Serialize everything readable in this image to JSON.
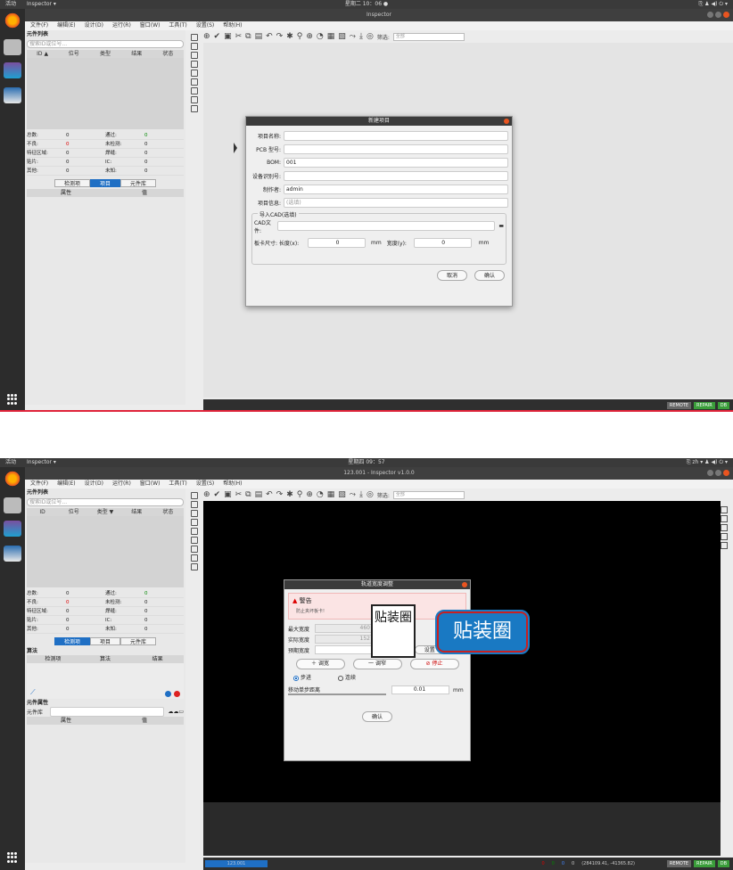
{
  "s1": {
    "topbar": {
      "activities": "活动",
      "app": "Inspector ▾",
      "clock": "星期二 10：06 ●",
      "tray": "⎘   ♟ ◀) ⏻ ▾"
    },
    "title": "Inspector",
    "menu": [
      "文件(F)",
      "编辑(E)",
      "设计(D)",
      "运行(R)",
      "窗口(W)",
      "工具(T)",
      "设置(S)",
      "帮助(H)"
    ],
    "left": {
      "title": "元件列表",
      "search_placeholder": "搜索ID或位号...",
      "cols": [
        "ID ▲",
        "位号",
        "类型",
        "结果",
        "状态"
      ],
      "stats": [
        [
          "总数:",
          "0",
          "通过:",
          "0"
        ],
        [
          "不良:",
          "0",
          "未检测:",
          "0"
        ],
        [
          "特征区域:",
          "0",
          "焊缝:",
          "0"
        ],
        [
          "贴片:",
          "0",
          "IC:",
          "0"
        ],
        [
          "其他:",
          "0",
          "未知:",
          "0"
        ]
      ],
      "tabs": [
        "检测项",
        "项目",
        "元件库"
      ],
      "attr_cols": [
        "属性",
        "值"
      ]
    },
    "filter_label": "筛选:",
    "filter_value": "全部",
    "dialog": {
      "title": "新建项目",
      "fields": [
        {
          "label": "项目名称:",
          "value": "",
          "ph": false
        },
        {
          "label": "PCB 型号:",
          "value": "",
          "ph": false
        },
        {
          "label": "BOM:",
          "value": "001",
          "ph": false
        },
        {
          "label": "设备识别号:",
          "value": "",
          "ph": false
        },
        {
          "label": "制作者:",
          "value": "admin",
          "ph": false
        },
        {
          "label": "项目信息:",
          "value": "(选填)",
          "ph": true
        }
      ],
      "group_label": "导入CAD(选填)",
      "cad_label": "CAD文件:",
      "size_label": "板卡尺寸: 长度(x):",
      "length": "0",
      "mm": "mm",
      "width_label": "宽度(y):",
      "width": "0",
      "cancel": "取消",
      "ok": "确认"
    },
    "status": {
      "remote": "REMOTE",
      "repair": "REPAIR",
      "db": "DB"
    }
  },
  "s2": {
    "topbar": {
      "activities": "活动",
      "app": "Inspector ▾",
      "clock": "星期四 09：57",
      "tray": "⎘  zh ▾   ♟ ◀) ⏻ ▾"
    },
    "title": "123.001 - Inspector v1.0.0",
    "left": {
      "tabs": [
        "检测项",
        "项目",
        "元件库"
      ],
      "algo_title": "算法",
      "algo_cols": [
        "检测项",
        "算法",
        "结果"
      ],
      "comp_title": "元件属性",
      "lib_label": "元件库",
      "attr_cols": [
        "属性",
        "值"
      ],
      "cols": [
        "ID",
        "位号",
        "类型 ▼",
        "结果",
        "状态"
      ]
    },
    "dialog": {
      "title": "轨道宽度调整",
      "warn_title": "警告",
      "warn_text": "防止夹坏板卡!",
      "max_label": "最大宽度",
      "max_val": "460",
      "act_label": "实际宽度",
      "act_val": "152",
      "exp_label": "预期宽度",
      "exp_val": "152",
      "mm": "mm",
      "set": "设置",
      "widen": "＋ 调宽",
      "narrow": "一 调窄",
      "stop": "⊘ 停止",
      "step": "步进",
      "cont": "连续",
      "move_label": "移动单步距离",
      "move_val": "0.01",
      "ok": "确认"
    },
    "watermark": {
      "seal": "贴装圈",
      "text": "贴装圈"
    },
    "status": {
      "left": "123.001",
      "n": [
        "0",
        "0",
        "0",
        "0"
      ],
      "coords": "(284109.41, -41365.82)",
      "remote": "REMOTE",
      "repair": "REPAIR",
      "db": "DB"
    }
  }
}
